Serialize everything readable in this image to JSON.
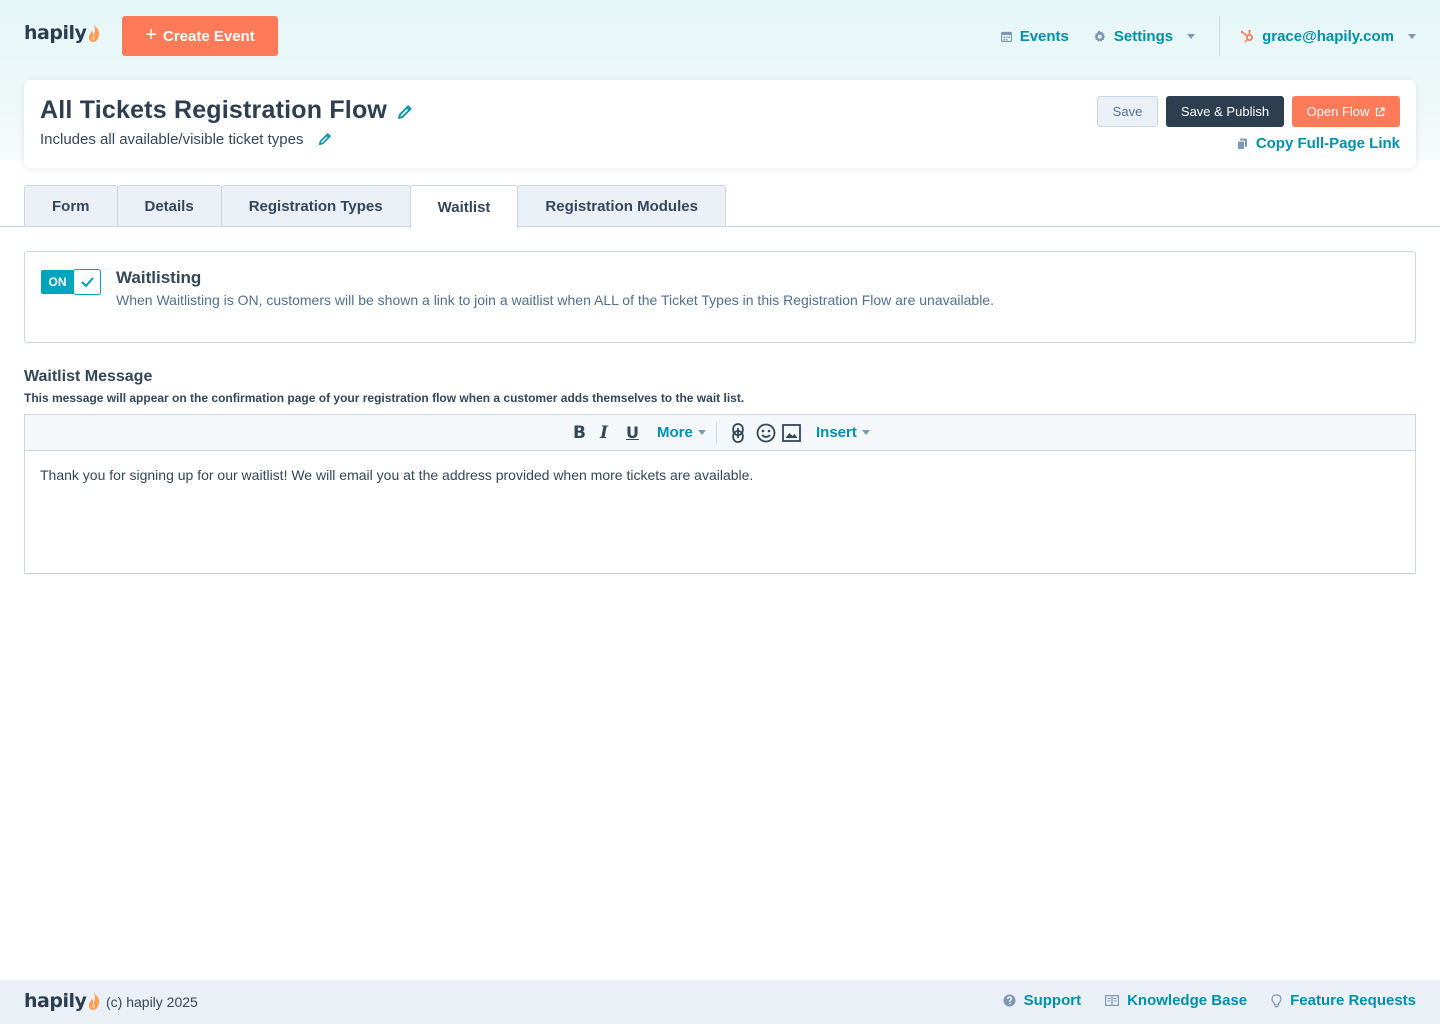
{
  "brand": {
    "name": "hapily",
    "accent": "#ff7a59",
    "teal": "#00a4bd",
    "link": "#0091ae"
  },
  "topnav": {
    "create_event_label": "Create Event",
    "events_label": "Events",
    "settings_label": "Settings",
    "user_email": "grace@hapily.com"
  },
  "header": {
    "title": "All Tickets Registration Flow",
    "subtitle": "Includes all available/visible ticket types",
    "save_label": "Save",
    "save_publish_label": "Save & Publish",
    "open_flow_label": "Open Flow",
    "copy_link_label": "Copy Full-Page Link"
  },
  "tabs": [
    {
      "label": "Form"
    },
    {
      "label": "Details"
    },
    {
      "label": "Registration Types"
    },
    {
      "label": "Waitlist",
      "active": true
    },
    {
      "label": "Registration Modules"
    }
  ],
  "waitlisting": {
    "toggle_label": "ON",
    "enabled": true,
    "title": "Waitlisting",
    "description": "When Waitlisting is ON, customers will be shown a link to join a waitlist when ALL of the Ticket Types in this Registration Flow are unavailable."
  },
  "waitlist_message": {
    "title": "Waitlist Message",
    "description": "This message will appear on the confirmation page of your registration flow when a customer adds themselves to the wait list.",
    "toolbar": {
      "bold": "B",
      "italic": "I",
      "underline": "U",
      "more": "More",
      "insert": "Insert"
    },
    "body": "Thank you for signing up for our waitlist! We will email you at the address provided when more tickets are available."
  },
  "footer": {
    "copyright": "(c) hapily 2025",
    "support": "Support",
    "knowledge_base": "Knowledge Base",
    "feature_requests": "Feature Requests"
  }
}
